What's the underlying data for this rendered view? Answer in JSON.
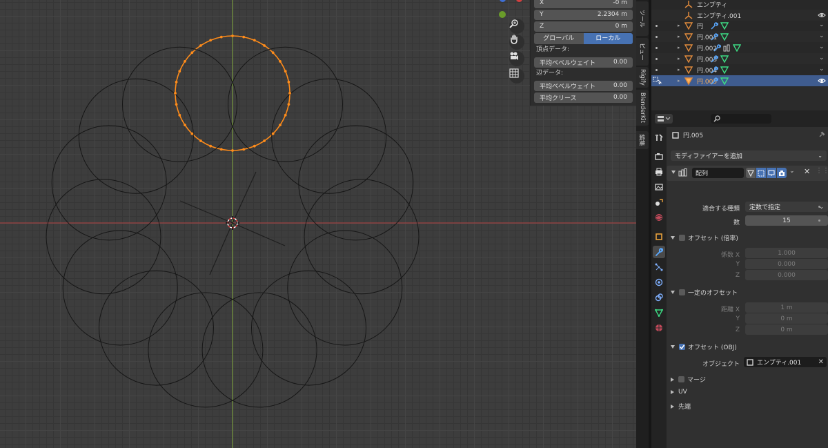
{
  "npanel": {
    "x_label": "X",
    "x_value": "-0 m",
    "y_label": "Y",
    "y_value": "2.2304 m",
    "z_label": "Z",
    "z_value": "0 m",
    "global_label": "グローバル",
    "local_label": "ローカル",
    "vertex_data_label": "頂点データ:",
    "vertex_bevel_label": "平均ベベルウェイト",
    "vertex_bevel_value": "0.00",
    "edge_data_label": "辺データ:",
    "edge_bevel_label": "平均ベベルウェイト",
    "edge_bevel_value": "0.00",
    "edge_crease_label": "平均クリース",
    "edge_crease_value": "0.00"
  },
  "side_tabs": [
    "ツール",
    "ビュー",
    "Rigify",
    "BlenderKit",
    "編集"
  ],
  "outliner": {
    "rows": [
      {
        "name": "エンプティ",
        "type": "empty"
      },
      {
        "name": "エンプティ.001",
        "type": "empty"
      },
      {
        "name": "円",
        "type": "mesh"
      },
      {
        "name": "円.001",
        "type": "mesh"
      },
      {
        "name": "円.002",
        "type": "mesh"
      },
      {
        "name": "円.003",
        "type": "mesh"
      },
      {
        "name": "円.004",
        "type": "mesh"
      },
      {
        "name": "円.005",
        "type": "mesh",
        "selected": true
      }
    ]
  },
  "properties": {
    "object_name": "円.005",
    "add_modifier_label": "モディファイアーを追加",
    "modifier_name": "配列",
    "fit_type_label": "適合する種類",
    "fit_type_value": "定数で指定",
    "count_label": "数",
    "count_value": "15",
    "relative_offset_label": "オフセット (倍率)",
    "factor_x_label": "係数 X",
    "factor_x_value": "1.000",
    "factor_y_label": "Y",
    "factor_y_value": "0.000",
    "factor_z_label": "Z",
    "factor_z_value": "0.000",
    "constant_offset_label": "一定のオフセット",
    "distance_x_label": "距離 X",
    "distance_x_value": "1 m",
    "distance_y_label": "Y",
    "distance_y_value": "0 m",
    "distance_z_label": "Z",
    "distance_z_value": "0 m",
    "object_offset_label": "オフセット (OBJ)",
    "object_label": "オブジェクト",
    "object_value": "エンプティ.001",
    "merge_label": "マージ",
    "uv_label": "UV",
    "caps_label": "先端"
  },
  "colors": {
    "accent": "#4772b3",
    "highlight": "#cc0000",
    "selection_orange": "#ff8c1a",
    "axis_x": "#c83c3c",
    "axis_y": "#80b030"
  },
  "array": {
    "count": 15
  }
}
